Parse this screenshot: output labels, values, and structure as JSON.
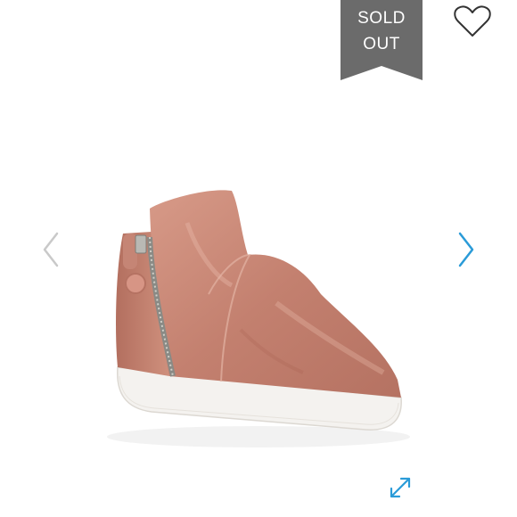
{
  "badge": {
    "line1": "SOLD",
    "line2": "OUT",
    "background_color": "#6b6b6b",
    "text_color": "#ffffff"
  },
  "icons": {
    "favorite": "heart-icon",
    "previous": "chevron-left-icon",
    "next": "chevron-right-icon",
    "expand": "expand-icon"
  },
  "colors": {
    "accent": "#2a9bd8",
    "prev_arrow": "#c9c9c9",
    "heart_outline": "#333333",
    "shoe_velvet": "#c98a7a",
    "sole": "#f4f2ef"
  }
}
